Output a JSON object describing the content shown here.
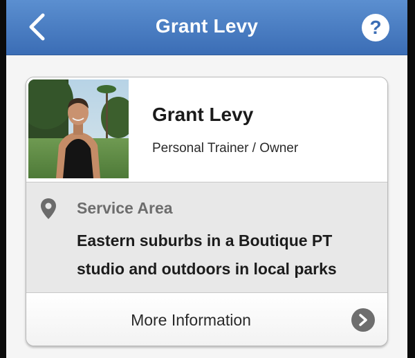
{
  "navbar": {
    "title": "Grant Levy",
    "back_icon": "chevron-left-icon",
    "help_icon": "question-icon",
    "help_symbol": "?",
    "color": "#4a7fc4"
  },
  "profile": {
    "name": "Grant Levy",
    "role": "Personal Trainer / Owner"
  },
  "service_area": {
    "icon": "map-pin-icon",
    "label": "Service Area",
    "text": "Eastern suburbs in a Boutique PT studio and outdoors in local parks"
  },
  "more_info": {
    "label": "More Information",
    "icon": "chevron-right-circle-icon"
  }
}
